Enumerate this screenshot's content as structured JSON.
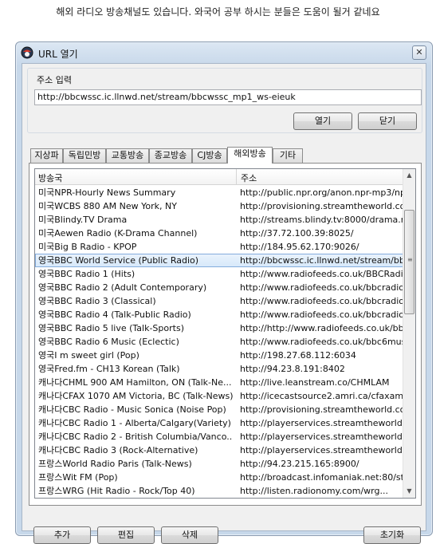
{
  "caption": "해외 라디오 방송채널도 있습니다. 와국어 공부 하시는 분들은 도움이 될거 같네요",
  "window": {
    "title": "URL 열기",
    "close_symbol": "✕"
  },
  "address": {
    "group_label": "주소 입력",
    "value": "http://bbcwssc.ic.llnwd.net/stream/bbcwssc_mp1_ws-eieuk",
    "open_label": "열기",
    "close_label": "닫기"
  },
  "tabs": [
    "지상파",
    "독립민방",
    "교통방송",
    "종교방송",
    "CJ방송",
    "해외방송",
    "기타"
  ],
  "active_tab_index": 5,
  "list": {
    "columns": [
      "방송국",
      "주소"
    ],
    "selected_index": 5,
    "rows": [
      [
        "미국NPR-Hourly News Summary",
        "http://public.npr.org/anon.npr-mp3/np..."
      ],
      [
        "미국WCBS 880 AM New York, NY",
        "http://provisioning.streamtheworld.co..."
      ],
      [
        "미국Blindy.TV Drama",
        "http://streams.blindy.tv:8000/drama.m..."
      ],
      [
        "미국Aewen Radio (K-Drama Channel)",
        "http://37.72.100.39:8025/"
      ],
      [
        "미국Big B Radio - KPOP",
        "http://184.95.62.170:9026/"
      ],
      [
        "영국BBC World Service (Public Radio)",
        "http://bbcwssc.ic.llnwd.net/stream/bbc..."
      ],
      [
        "영국BBC Radio 1 (Hits)",
        "http://www.radiofeeds.co.uk/BBCRadio..."
      ],
      [
        "영국BBC Radio 2 (Adult Contemporary)",
        "http://www.radiofeeds.co.uk/bbcradio..."
      ],
      [
        "영국BBC Radio 3 (Classical)",
        "http://www.radiofeeds.co.uk/bbcradio..."
      ],
      [
        "영국BBC Radio 4 (Talk-Public Radio)",
        "http://www.radiofeeds.co.uk/bbcradio..."
      ],
      [
        "영국BBC Radio 5 live (Talk-Sports)",
        "http://http://www.radiofeeds.co.uk/bbc..."
      ],
      [
        "영국BBC Radio 6 Music (Eclectic)",
        "http://www.radiofeeds.co.uk/bbc6musi..."
      ],
      [
        "영국I m sweet girl (Pop)",
        "http://198.27.68.112:6034"
      ],
      [
        "영국Fred.fm - CH13 Korean (Talk)",
        "http://94.23.8.191:8402"
      ],
      [
        "캐나다CHML 900 AM Hamilton, ON (Talk-Ne...",
        "http://live.leanstream.co/CHMLAM"
      ],
      [
        "캐나다CFAX 1070 AM Victoria, BC (Talk-News)",
        "http://icecastsource2.amri.ca/cfaxam-..."
      ],
      [
        "캐나다CBC Radio - Music Sonica (Noise Pop)",
        "http://provisioning.streamtheworld.co..."
      ],
      [
        "캐나다CBC Radio 1 - Alberta/Calgary(Variety)",
        "http://playerservices.streamtheworld.c..."
      ],
      [
        "캐나다CBC Radio 2 - British Columbia/Vanco...",
        "http://playerservices.streamtheworld.c..."
      ],
      [
        "캐나다CBC Radio 3 (Rock-Alternative)",
        "http://playerservices.streamtheworld.c..."
      ],
      [
        "프랑스World Radio Paris (Talk-News)",
        "http://94.23.215.165:8900/"
      ],
      [
        "프랑스Wit FM (Pop)",
        "http://broadcast.infomaniak.net:80/sta..."
      ],
      [
        "프랑스WRG (Hit Radio - Rock/Top 40)",
        "http://listen.radionomy.com/wrg..."
      ]
    ]
  },
  "buttons": {
    "add": "추가",
    "edit": "편집",
    "delete": "삭제",
    "reset": "초기화"
  }
}
